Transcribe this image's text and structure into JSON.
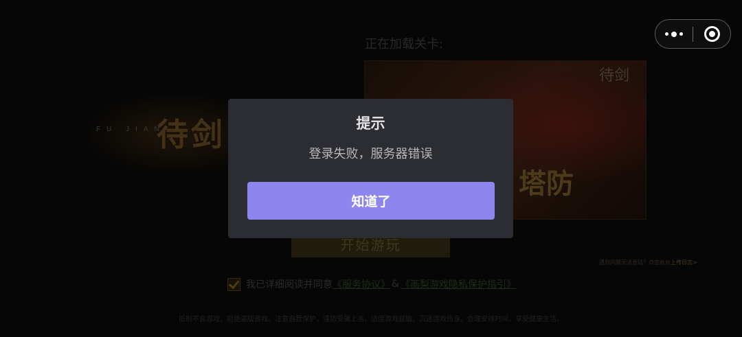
{
  "background": {
    "logo_text": "待剑",
    "logo_sub": "FU JIAN",
    "loading_label": "正在加载关卡:",
    "poster_text": "塔防",
    "poster_corner_text": "待剑",
    "start_button": "开始游玩",
    "help_text": "遇到问题无法登陆？点击此处",
    "help_link": "上传日志>",
    "agree_prefix": "我已详细阅读并同意",
    "agree_link_1": "《服务协议》",
    "agree_amp": "&",
    "agree_link_2": "《画梨游戏隐私保护指引》",
    "health_notice": "抵制不良游戏，拒绝盗版游戏。注意自我保护，谨防受骗上当。适度游戏益脑，沉迷游戏伤身。合理安排时间，享受健康生活。"
  },
  "capsule": {
    "more_icon": "more-dots-icon",
    "close_icon": "target-close-icon"
  },
  "modal": {
    "title": "提示",
    "message": "登录失败，服务器错误",
    "confirm_label": "知道了",
    "button_color": "#8e86ee"
  }
}
